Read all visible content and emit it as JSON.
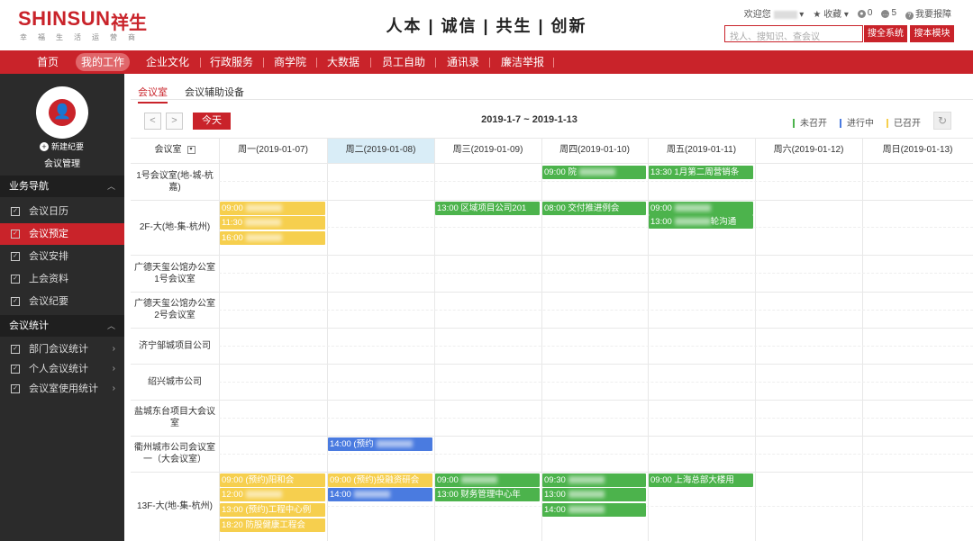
{
  "header": {
    "logo": "SHINSUN",
    "logo_cn": "祥生",
    "tagline": "幸福生活运营商",
    "slogan": "人本 | 诚信 | 共生 | 创新",
    "welcome": "欢迎您",
    "favorites": "收藏",
    "msg_count": "0",
    "notice_count": "5",
    "report": "我要报障",
    "search_placeholder": "找人、搜知识、查会议",
    "search_all": "搜全系统",
    "search_module": "搜本模块"
  },
  "nav": [
    "首页",
    "我的工作",
    "企业文化",
    "行政服务",
    "商学院",
    "大数据",
    "员工自助",
    "通讯录",
    "廉洁举报"
  ],
  "sidebar": {
    "new_record": "新建纪要",
    "meeting_mgmt": "会议管理",
    "sec1": "业务导航",
    "sec1_items": [
      "会议日历",
      "会议预定",
      "会议安排",
      "上会资料",
      "会议纪要"
    ],
    "sec2": "会议统计",
    "sec2_items": [
      "部门会议统计",
      "个人会议统计",
      "会议室使用统计"
    ]
  },
  "tabs": [
    "会议室",
    "会议辅助设备"
  ],
  "toolbar": {
    "prev": "<",
    "next": ">",
    "today": "今天",
    "range": "2019-1-7 ~ 2019-1-13",
    "legend": [
      {
        "label": "未召开",
        "color": "#4cb34c"
      },
      {
        "label": "进行中",
        "color": "#4a7be0"
      },
      {
        "label": "已召开",
        "color": "#f6cf4e"
      }
    ],
    "refresh": "↻"
  },
  "grid": {
    "room_header": "会议室",
    "days": [
      "周一(2019-01-07)",
      "周二(2019-01-08)",
      "周三(2019-01-09)",
      "周四(2019-01-10)",
      "周五(2019-01-11)",
      "周六(2019-01-12)",
      "周日(2019-01-13)"
    ],
    "rooms": [
      "1号会议室(地-城-杭嘉)",
      "2F-大(地-集-杭州)",
      "广德天玺公馆办公室1号会议室",
      "广德天玺公馆办公室2号会议室",
      "济宁邹城项目公司",
      "绍兴城市公司",
      "盐城东台项目大会议室",
      "衢州城市公司会议室一（大会议室）",
      "13F-大(地-集-杭州)"
    ],
    "events": {
      "e1": "09:00 院",
      "e2": "13:30 1月第二周营销条",
      "e3": "09:00",
      "e4": "11:30",
      "e5": "16:00",
      "e6": "13:00 区域项目公司201",
      "e7": "08:00 交付推进例会",
      "e8": "09:00",
      "e9": "13:00",
      "e9b": "轮沟通",
      "e10": "14:00 (预约",
      "e11": "09:00 (预约)阳和会",
      "e12": "12:00",
      "e13": "13:00 (预约)工程中心例",
      "e14": "18:20 防股健康工程会",
      "e15": "09:00 (预约)投融资研会",
      "e16": "14:00",
      "e17": "09:00",
      "e18": "13:00 财务管理中心年",
      "e19": "09:30",
      "e20": "13:00",
      "e21": "14:00",
      "e22": "09:00 上海总部大楼用"
    }
  }
}
